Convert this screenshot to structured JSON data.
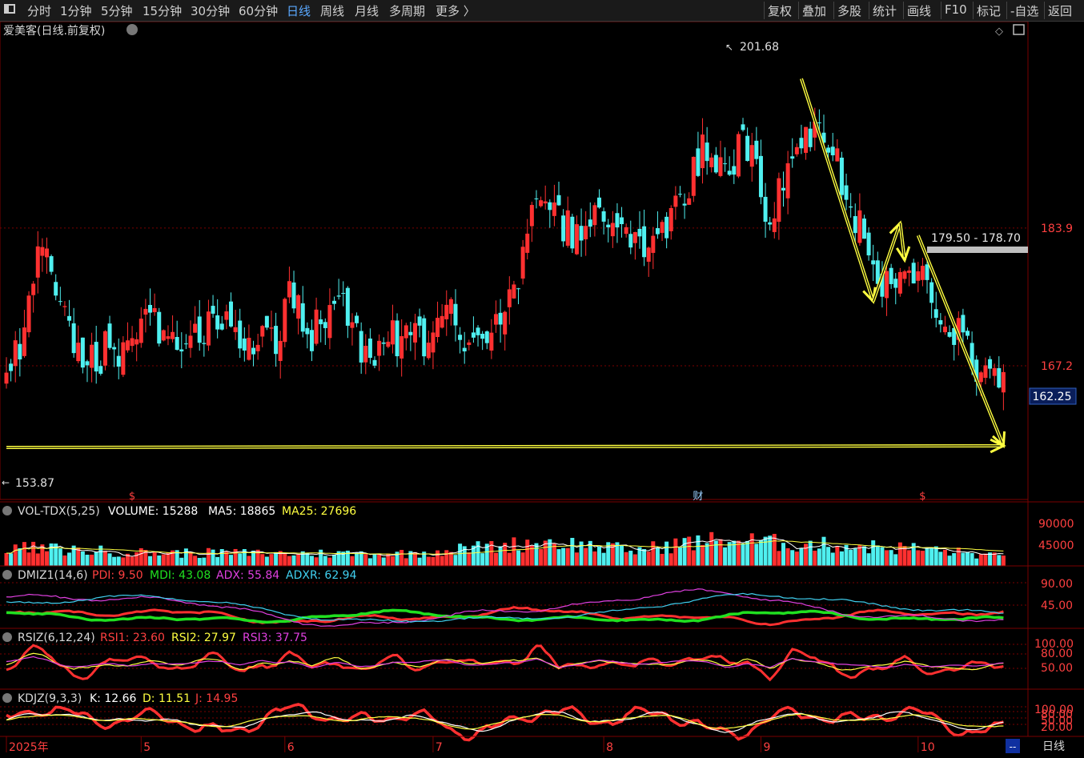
{
  "toolbar": {
    "left": [
      "分时",
      "1分钟",
      "5分钟",
      "15分钟",
      "30分钟",
      "60分钟",
      "日线",
      "周线",
      "月线",
      "多周期",
      "更多 〉"
    ],
    "active": "日线",
    "right": [
      "复权",
      "叠加",
      "多股",
      "统计",
      "画线",
      "F10",
      "标记",
      "-自选",
      "返回"
    ]
  },
  "main": {
    "title": "爱美客(日线.前复权)",
    "y_ticks": [
      "183.9",
      "167.2"
    ],
    "current_price": "162.25",
    "max_label": "201.68",
    "min_label": "153.87",
    "range_label": "179.50 - 178.70",
    "event_marks": [
      {
        "i": 28,
        "t": "$"
      },
      {
        "i": 154,
        "t": "财"
      },
      {
        "i": 204,
        "t": "$"
      }
    ],
    "arrows": [
      {
        "from": [
          177,
          202
        ],
        "to": [
          193,
          175
        ]
      },
      {
        "from": [
          193,
          175
        ],
        "to": [
          199,
          184.5
        ]
      },
      {
        "from": [
          199,
          184.5
        ],
        "to": [
          200,
          180
        ]
      },
      {
        "from": [
          203,
          183
        ],
        "to": [
          222,
          157.5
        ]
      },
      {
        "from": [
          0,
          157.3
        ],
        "to": [
          222,
          157.5
        ]
      }
    ]
  },
  "vol_panel": {
    "name": "VOL-TDX(5,25)",
    "volume_label": "VOLUME: 15288",
    "ma5_label": "MA5: 18865",
    "ma25_label": "MA25: 27696",
    "y_ticks": [
      "90000",
      "45000"
    ]
  },
  "dmi_panel": {
    "name": "DMIZ1(14,6)",
    "pdi_label": "PDI: 9.50",
    "mdi_label": "MDI: 43.08",
    "adx_label": "ADX: 55.84",
    "adxr_label": "ADXR: 62.94",
    "y_ticks": [
      "90.00",
      "45.00"
    ]
  },
  "rsi_panel": {
    "name": "RSIZ(6,12,24)",
    "rsi1_label": "RSI1: 23.60",
    "rsi2_label": "RSI2: 27.97",
    "rsi3_label": "RSI3: 37.75",
    "y_ticks": [
      "100.00",
      "80.00",
      "50.00"
    ]
  },
  "kdj_panel": {
    "name": "KDJZ(9,3,3)",
    "k_label": "K: 12.66",
    "d_label": "D: 11.51",
    "j_label": "J: 14.95",
    "y_ticks": [
      "100.00",
      "80.00",
      "50.00",
      "20.00"
    ]
  },
  "x_axis": {
    "labels": [
      {
        "i": 0,
        "t": "2025年"
      },
      {
        "i": 30,
        "t": "5"
      },
      {
        "i": 62,
        "t": "6"
      },
      {
        "i": 95,
        "t": "7"
      },
      {
        "i": 133,
        "t": "8"
      },
      {
        "i": 168,
        "t": "9"
      },
      {
        "i": 203,
        "t": "10"
      }
    ],
    "right_label": "日线",
    "end_marker": "--"
  },
  "colors": {
    "up": "#ff3030",
    "down": "#4ff0f0",
    "bg": "#000000",
    "grid": "#7a0000",
    "yellow": "#ffff40"
  },
  "chart_data": {
    "type": "candlestick",
    "y_range": [
      151,
      206
    ],
    "keypoints": [
      [
        0,
        166
      ],
      [
        3,
        170
      ],
      [
        6,
        179
      ],
      [
        10,
        180
      ],
      [
        14,
        172
      ],
      [
        18,
        167
      ],
      [
        22,
        169
      ],
      [
        28,
        170
      ],
      [
        32,
        173
      ],
      [
        40,
        169
      ],
      [
        44,
        172
      ],
      [
        48,
        174
      ],
      [
        52,
        168
      ],
      [
        56,
        171
      ],
      [
        60,
        170
      ],
      [
        63,
        176
      ],
      [
        68,
        171
      ],
      [
        74,
        176
      ],
      [
        78,
        170
      ],
      [
        82,
        168
      ],
      [
        86,
        171
      ],
      [
        92,
        170
      ],
      [
        98,
        174
      ],
      [
        102,
        171
      ],
      [
        108,
        172
      ],
      [
        114,
        177
      ],
      [
        118,
        189
      ],
      [
        122,
        185
      ],
      [
        127,
        183
      ],
      [
        132,
        186
      ],
      [
        137,
        184
      ],
      [
        140,
        181
      ],
      [
        146,
        183
      ],
      [
        150,
        187
      ],
      [
        156,
        194
      ],
      [
        160,
        191
      ],
      [
        165,
        194
      ],
      [
        170,
        184
      ],
      [
        174,
        192
      ],
      [
        180,
        196
      ],
      [
        184,
        193
      ],
      [
        188,
        187
      ],
      [
        192,
        182
      ],
      [
        195,
        178
      ],
      [
        198,
        179
      ],
      [
        201,
        181
      ],
      [
        204,
        177
      ],
      [
        207,
        174
      ],
      [
        210,
        172
      ],
      [
        213,
        170
      ],
      [
        216,
        167
      ],
      [
        219,
        166.5
      ],
      [
        222,
        166
      ]
    ],
    "seed": 20250101,
    "volume_keypoints": [
      [
        0,
        0.42
      ],
      [
        30,
        0.3
      ],
      [
        60,
        0.28
      ],
      [
        90,
        0.28
      ],
      [
        115,
        0.5
      ],
      [
        120,
        0.55
      ],
      [
        140,
        0.35
      ],
      [
        150,
        0.5
      ],
      [
        160,
        0.6
      ],
      [
        175,
        0.5
      ],
      [
        190,
        0.45
      ],
      [
        205,
        0.38
      ],
      [
        222,
        0.2
      ]
    ]
  }
}
